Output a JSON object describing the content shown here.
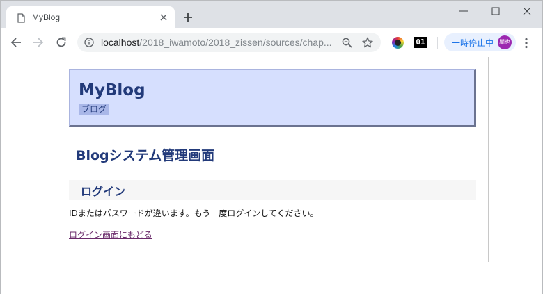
{
  "browser": {
    "tab_title": "MyBlog",
    "url_host": "localhost",
    "url_path": "/2018_iwamoto/2018_zissen/sources/chap...",
    "ext_badge_text": "01",
    "profile_status": "一時停止中",
    "profile_initials": "朋也",
    "accent_color": "#1a73e8",
    "icons": {
      "tab": "document-icon",
      "close": "close-icon",
      "new_tab": "plus-icon",
      "back": "arrow-left-icon",
      "forward": "arrow-right-icon",
      "reload": "reload-icon",
      "info": "info-icon",
      "zoom": "zoom-icon",
      "bookmark": "star-icon",
      "menu": "more-vert-icon"
    }
  },
  "page": {
    "site_title": "MyBlog",
    "site_tag": "ブログ",
    "section_title": "Blogシステム管理画面",
    "sub_title": "ログイン",
    "message": "IDまたはパスワードが違います。もう一度ログインしてください。",
    "back_link": "ログイン画面にもどる",
    "header_bg": "#d6dffe",
    "title_color": "#223a7a"
  }
}
